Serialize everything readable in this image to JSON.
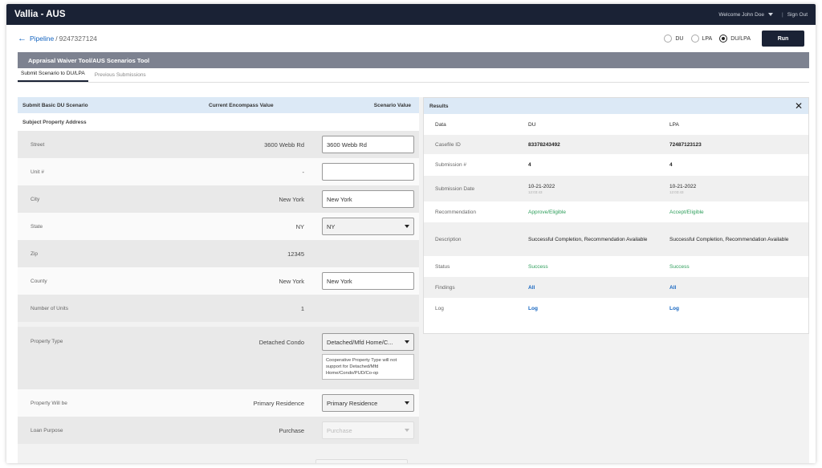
{
  "header": {
    "app_title": "Vallia - AUS",
    "welcome": "Welcome John Doe",
    "sign_out": "Sign Out"
  },
  "breadcrumb": {
    "pipeline": "Pipeline",
    "separator": "/",
    "loan_number": "9247327124"
  },
  "mode": {
    "options": [
      "DU",
      "LPA",
      "DU/LPA"
    ],
    "selected": "DU/LPA",
    "run_label": "Run"
  },
  "section_title": "Appraisal Waiver Tool/AUS Scenarios Tool",
  "tabs": [
    {
      "label": "Submit Scenario to DU/LPA",
      "active": true
    },
    {
      "label": "Previous Submissions",
      "active": false
    }
  ],
  "scenario": {
    "headers": {
      "title": "Submit Basic DU Scenario",
      "current": "Current Encompass Value",
      "scenario": "Scenario Value"
    },
    "subject_title": "Subject Property Address",
    "rows": [
      {
        "label": "Street",
        "current": "3600 Webb Rd",
        "value": "3600 Webb Rd"
      },
      {
        "label": "Unit #",
        "current": "-",
        "value": ""
      },
      {
        "label": "City",
        "current": "New York",
        "value": "New York"
      },
      {
        "label": "State",
        "current": "NY",
        "value": "NY"
      },
      {
        "label": "Zip",
        "current": "12345",
        "value": "12345"
      },
      {
        "label": "County",
        "current": "New York",
        "value": "New York"
      },
      {
        "label": "Number of Units",
        "current": "1",
        "value": "1"
      }
    ],
    "property_type": {
      "label": "Property Type",
      "current": "Detached Condo",
      "value": "Detached/Mfd Home/C...",
      "note": "Cooperative Property Type will not support for Detached/Mfd Home/Condo/PUD/Co-op"
    },
    "property_will_be": {
      "label": "Property Will be",
      "current": "Primary Residence",
      "value": "Primary Residence"
    },
    "loan_purpose": {
      "label": "Loan Purpose",
      "current": "Purchase",
      "value": "Purchase"
    }
  },
  "results": {
    "title": "Results",
    "headers": {
      "data": "Data",
      "du": "DU",
      "lpa": "LPA"
    },
    "casefile": {
      "label": "Casefile ID",
      "du": "83378243492",
      "lpa": "72487123123"
    },
    "submission_no": {
      "label": "Submission #",
      "du": "4",
      "lpa": "4"
    },
    "submission_date": {
      "label": "Submission Date",
      "du": "10-21-2022",
      "du_time": "12:03:43",
      "lpa": "10-21-2022",
      "lpa_time": "12:03:43"
    },
    "recommendation": {
      "label": "Recommendation",
      "du": "Approve/Eligible",
      "lpa": "Accept/Eligible"
    },
    "description": {
      "label": "Description",
      "du": "Successful Completion, Recommendation Available",
      "lpa": "Successful Completion, Recommendation Available"
    },
    "status": {
      "label": "Status",
      "du": "Success",
      "lpa": "Success"
    },
    "findings": {
      "label": "Findings",
      "du": "All",
      "lpa": "All"
    },
    "log": {
      "label": "Log",
      "du": "Log",
      "lpa": "Log"
    }
  },
  "colors": {
    "nav_bg": "#1a2235",
    "section_bar": "#7d8290",
    "header_tint": "#dce9f6",
    "success": "#2e9e5b",
    "link": "#1565c0"
  },
  "icons": {
    "back": "arrow-left-icon",
    "close": "close-icon",
    "dropdown": "caret-down-icon"
  }
}
